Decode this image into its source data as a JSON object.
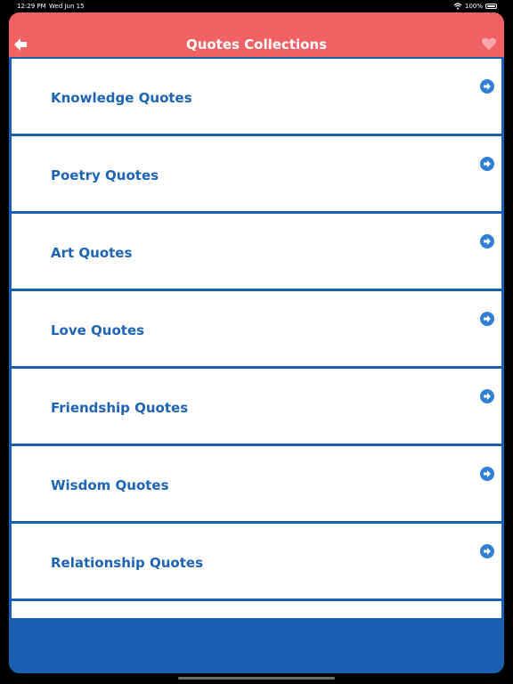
{
  "status_bar": {
    "time": "12:29 PM",
    "date": "Wed Jun 15",
    "battery": "100%"
  },
  "nav": {
    "title": "Quotes Collections"
  },
  "colors": {
    "nav_bar": "#f26264",
    "blue_background": "#1b5fb4",
    "item_text": "#1d64b4",
    "arrow_icon": "#2f7fd6"
  },
  "icons": {
    "back": "back-arrow-icon",
    "favorite": "heart-icon",
    "item": "circle-arrow-right-icon"
  },
  "list": {
    "items": [
      {
        "label": "Knowledge Quotes"
      },
      {
        "label": "Poetry Quotes"
      },
      {
        "label": "Art Quotes"
      },
      {
        "label": "Love Quotes"
      },
      {
        "label": "Friendship Quotes"
      },
      {
        "label": "Wisdom Quotes"
      },
      {
        "label": "Relationship Quotes"
      }
    ]
  }
}
